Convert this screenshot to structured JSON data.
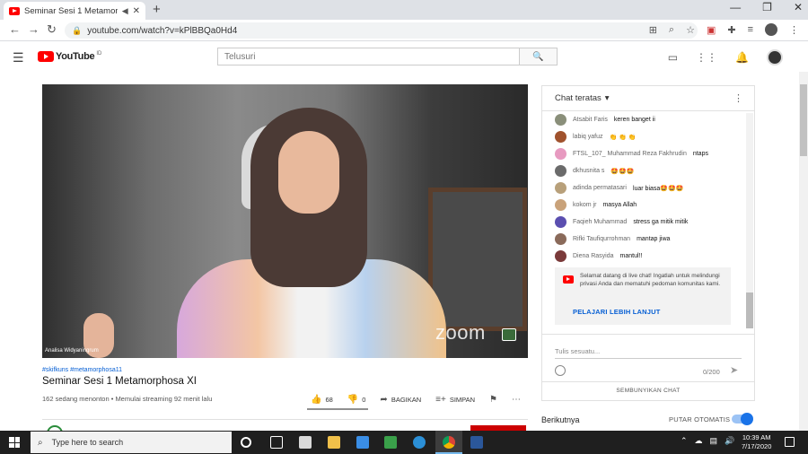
{
  "browser": {
    "tab_title": "Seminar Sesi 1 Metamorphos",
    "tab_audio": "◀",
    "tab_close": "✕",
    "new_tab": "+",
    "window_controls": [
      "—",
      "❐",
      "✕"
    ],
    "nav": {
      "back": "←",
      "forward": "→",
      "reload": "↻"
    },
    "url": "youtube.com/watch?v=kPlBBQa0Hd4",
    "lock": "🔒"
  },
  "youtube": {
    "logo_text": "YouTube",
    "logo_reg": "ID",
    "search_placeholder": "Telusuri",
    "search_icon": "🔍"
  },
  "video": {
    "presenter_name": "Analisa Widyaningrum",
    "watermark": "zoom",
    "hashtags": "#skifkuns #metamorphosa11",
    "title": "Seminar Sesi 1 Metamorphosa XI",
    "stats": "162 sedang menonton • Memulai streaming 92 menit lalu",
    "likes": "68",
    "dislikes": "0",
    "like_ratio": 1.0,
    "share_label": "BAGIKAN",
    "save_label": "SIMPAN"
  },
  "chat": {
    "header": "Chat teratas",
    "messages": [
      {
        "author": "Atsabit Faris",
        "text": "keren banget ii",
        "color": "#8a8f7a"
      },
      {
        "author": "labiq yafuz",
        "text": "👏 👏 👏",
        "color": "#a0522d"
      },
      {
        "author": "FTSL_107_ Muhammad Reza Fakhrudin",
        "text": "ntaps",
        "color": "#e79ac0"
      },
      {
        "author": "dkhusnita s",
        "text": "🤩🤩🤩",
        "color": "#6b6b6b"
      },
      {
        "author": "adinda permatasari",
        "text": "luar biasa🤩🤩🤩",
        "color": "#b8a07a"
      },
      {
        "author": "kokom jr",
        "text": "masya Allah",
        "color": "#c9a27a"
      },
      {
        "author": "Faqieh Muhammad",
        "text": "stress ga mitik mitik",
        "color": "#5b4fb0"
      },
      {
        "author": "Rifki Taufiqurrohman",
        "text": "mantap jiwa",
        "color": "#8a6a5a"
      },
      {
        "author": "Diena Rasyida",
        "text": "mantul!!",
        "color": "#7a3a3a"
      }
    ],
    "welcome_text": "Selamat datang di live chat! Ingatlah untuk melindungi privasi Anda dan mematuhi pedoman komunitas kami.",
    "welcome_link": "PELAJARI LEBIH LANJUT",
    "input_placeholder": "Tulis sesuatu...",
    "char_count": "0/200",
    "hide_chat": "SEMBUNYIKAN CHAT"
  },
  "upnext": {
    "label": "Berikutnya",
    "autoplay_label": "PUTAR OTOMATIS"
  },
  "taskbar": {
    "search_placeholder": "Type here to search",
    "time": "10:39 AM",
    "date": "7/17/2020"
  },
  "colors": {
    "accent_red": "#ff0000",
    "link_blue": "#065fd4"
  }
}
